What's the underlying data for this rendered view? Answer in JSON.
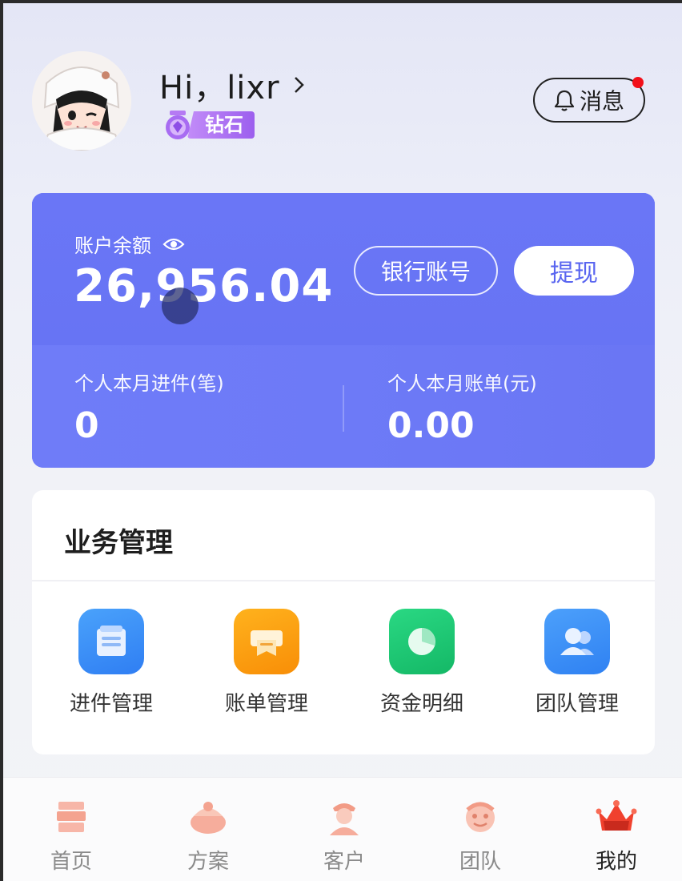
{
  "header": {
    "greeting": "Hi，lixr",
    "level": "钻石",
    "message_label": "消息"
  },
  "balance_card": {
    "balance_label": "账户余额",
    "balance_value": "26,956.04",
    "bank_button": "银行账号",
    "withdraw_button": "提现",
    "stats": [
      {
        "label": "个人本月进件(笔)",
        "value": "0"
      },
      {
        "label": "个人本月账单(元)",
        "value": "0.00"
      }
    ]
  },
  "business": {
    "title": "业务管理",
    "items": [
      {
        "label": "进件管理",
        "icon": "document-icon",
        "color": "#3d8af7"
      },
      {
        "label": "账单管理",
        "icon": "bill-icon",
        "color": "#fb9c0a"
      },
      {
        "label": "资金明细",
        "icon": "pie-chart-icon",
        "color": "#1dc874"
      },
      {
        "label": "团队管理",
        "icon": "team-icon",
        "color": "#3f8ff5"
      }
    ]
  },
  "tabbar": {
    "items": [
      {
        "label": "首页",
        "icon": "home-icon"
      },
      {
        "label": "方案",
        "icon": "plan-icon"
      },
      {
        "label": "客户",
        "icon": "customer-icon"
      },
      {
        "label": "团队",
        "icon": "team-tab-icon"
      },
      {
        "label": "我的",
        "icon": "crown-icon",
        "active": true
      }
    ]
  },
  "colors": {
    "card": "#6b78f5",
    "badge_dot": "#f2101a",
    "level_badge": "#a86cf2"
  }
}
